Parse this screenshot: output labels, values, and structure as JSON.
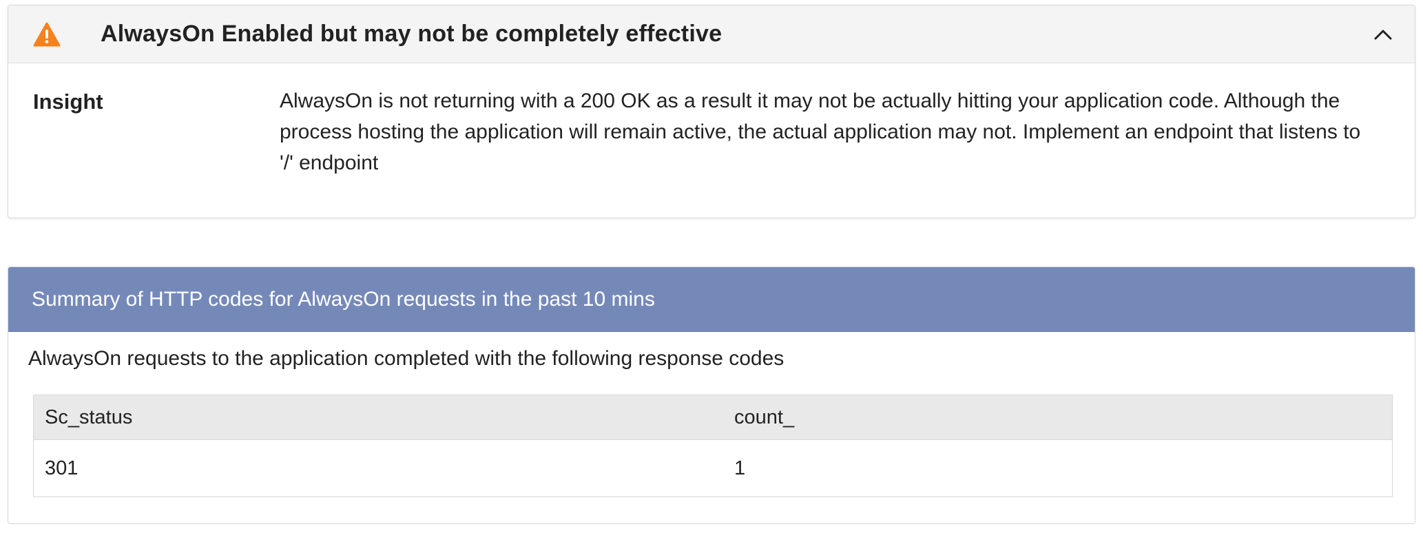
{
  "insight": {
    "title": "AlwaysOn Enabled but may not be completely effective",
    "label": "Insight",
    "text": "AlwaysOn is not returning with a 200 OK as a result it may not be actually hitting your application code. Although the process hosting the application will remain active, the actual application may not. Implement an endpoint that listens to '/' endpoint",
    "icons": {
      "status": "warning-icon",
      "toggle": "chevron-up-icon"
    },
    "colors": {
      "warning": "#f5821f"
    }
  },
  "summary": {
    "title": "Summary of HTTP codes for AlwaysOn requests in the past 10 mins",
    "description": "AlwaysOn requests to the application completed with the following response codes",
    "table": {
      "columns": [
        "Sc_status",
        "count_"
      ],
      "rows": [
        [
          "301",
          "1"
        ]
      ]
    },
    "colors": {
      "header": "#7589b9"
    }
  }
}
